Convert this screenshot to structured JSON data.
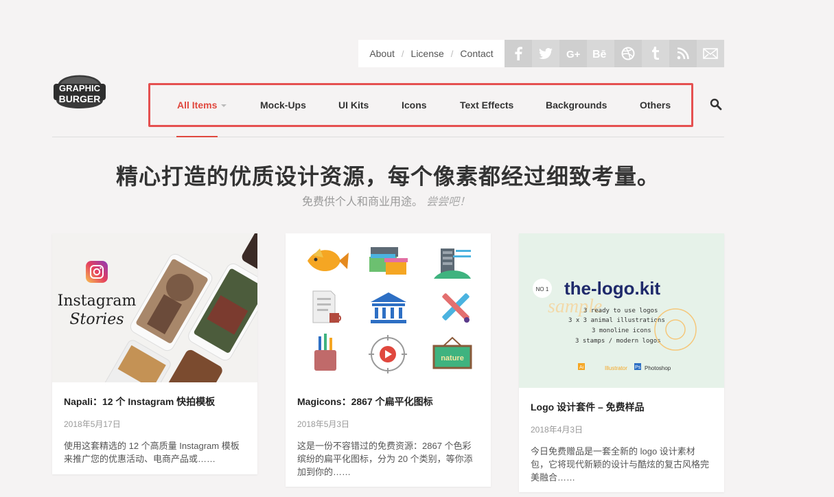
{
  "top_links": [
    "About",
    "License",
    "Contact"
  ],
  "social": [
    "facebook-icon",
    "twitter-icon",
    "google-plus-icon",
    "behance-icon",
    "dribbble-icon",
    "tumblr-icon",
    "rss-icon",
    "mail-icon"
  ],
  "logo": {
    "line1": "GRAPHIC",
    "line2": "BURGER"
  },
  "nav": {
    "items": [
      "All Items",
      "Mock-Ups",
      "UI Kits",
      "Icons",
      "Text Effects",
      "Backgrounds",
      "Others"
    ],
    "active": "All Items"
  },
  "hero": {
    "headline": "精心打造的优质设计资源，每个像素都经过细致考量。",
    "sub": "免费供个人和商业用途。",
    "sub_em": "尝尝吧！"
  },
  "cards": [
    {
      "thumb_title1": "Instagram",
      "thumb_title2": "Stories",
      "title": "Napali：12 个 Instagram 快拍模板",
      "date": "2018年5月17日",
      "excerpt": "使用这套精选的 12 个高质量 Instagram 模板来推广您的优惠活动、电商产品或……"
    },
    {
      "thumb_label": "nature",
      "title": "Magicons：2867 个扁平化图标",
      "date": "2018年5月3日",
      "excerpt": "这是一份不容错过的免费资源：2867 个色彩缤纷的扁平化图标，分为 20 个类别，等你添加到你的……"
    },
    {
      "thumb": {
        "badge": "NO 1",
        "brand": "the-logo.kit",
        "sample": "sample",
        "lines": [
          "3 ready to use logos",
          "3 x 3 animal illustrations",
          "3 monoline icons",
          "3 stamps / modern logos"
        ],
        "ai": "Ai",
        "ai_label": "Illustrator",
        "ps": "Ps",
        "ps_label": "Photoshop"
      },
      "title": "Logo 设计套件 – 免费样品",
      "date": "2018年4月3日",
      "excerpt": "今日免费赠品是一套全新的 logo 设计素材包，它将现代新颖的设计与酷炫的复古风格完美融合……"
    }
  ]
}
